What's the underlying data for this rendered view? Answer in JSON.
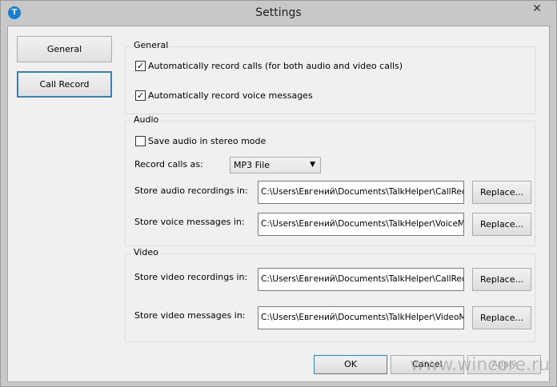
{
  "window": {
    "title": "Settings",
    "app_icon": "T",
    "close_glyph": "✕"
  },
  "nav": {
    "general": "General",
    "call_record": "Call Record"
  },
  "general_group": {
    "label": "General",
    "auto_record_calls": {
      "label": "Automatically record calls (for both audio and video calls)",
      "checked": true
    },
    "auto_record_voice": {
      "label": "Automatically record voice messages",
      "checked": true
    }
  },
  "audio_group": {
    "label": "Audio",
    "stereo": {
      "label": "Save audio in stereo mode",
      "checked": false
    },
    "record_as_label": "Record calls as:",
    "record_as_value": "MP3 File",
    "audio_rec_label": "Store audio recordings in:",
    "audio_rec_path": "C:\\Users\\Евгений\\Documents\\TalkHelper\\CallRecordings",
    "voice_msg_label": "Store voice messages in:",
    "voice_msg_path": "C:\\Users\\Евгений\\Documents\\TalkHelper\\VoiceMessages"
  },
  "video_group": {
    "label": "Video",
    "video_rec_label": "Store video recordings in:",
    "video_rec_path": "C:\\Users\\Евгений\\Documents\\TalkHelper\\CallRecordings",
    "video_msg_label": "Store video messages in:",
    "video_msg_path": "C:\\Users\\Евгений\\Documents\\TalkHelper\\VideoMessages"
  },
  "replace_label": "Replace...",
  "footer": {
    "ok": "OK",
    "cancel": "Cancel",
    "apply": "Apply"
  },
  "watermark": "www.wincore.ru"
}
